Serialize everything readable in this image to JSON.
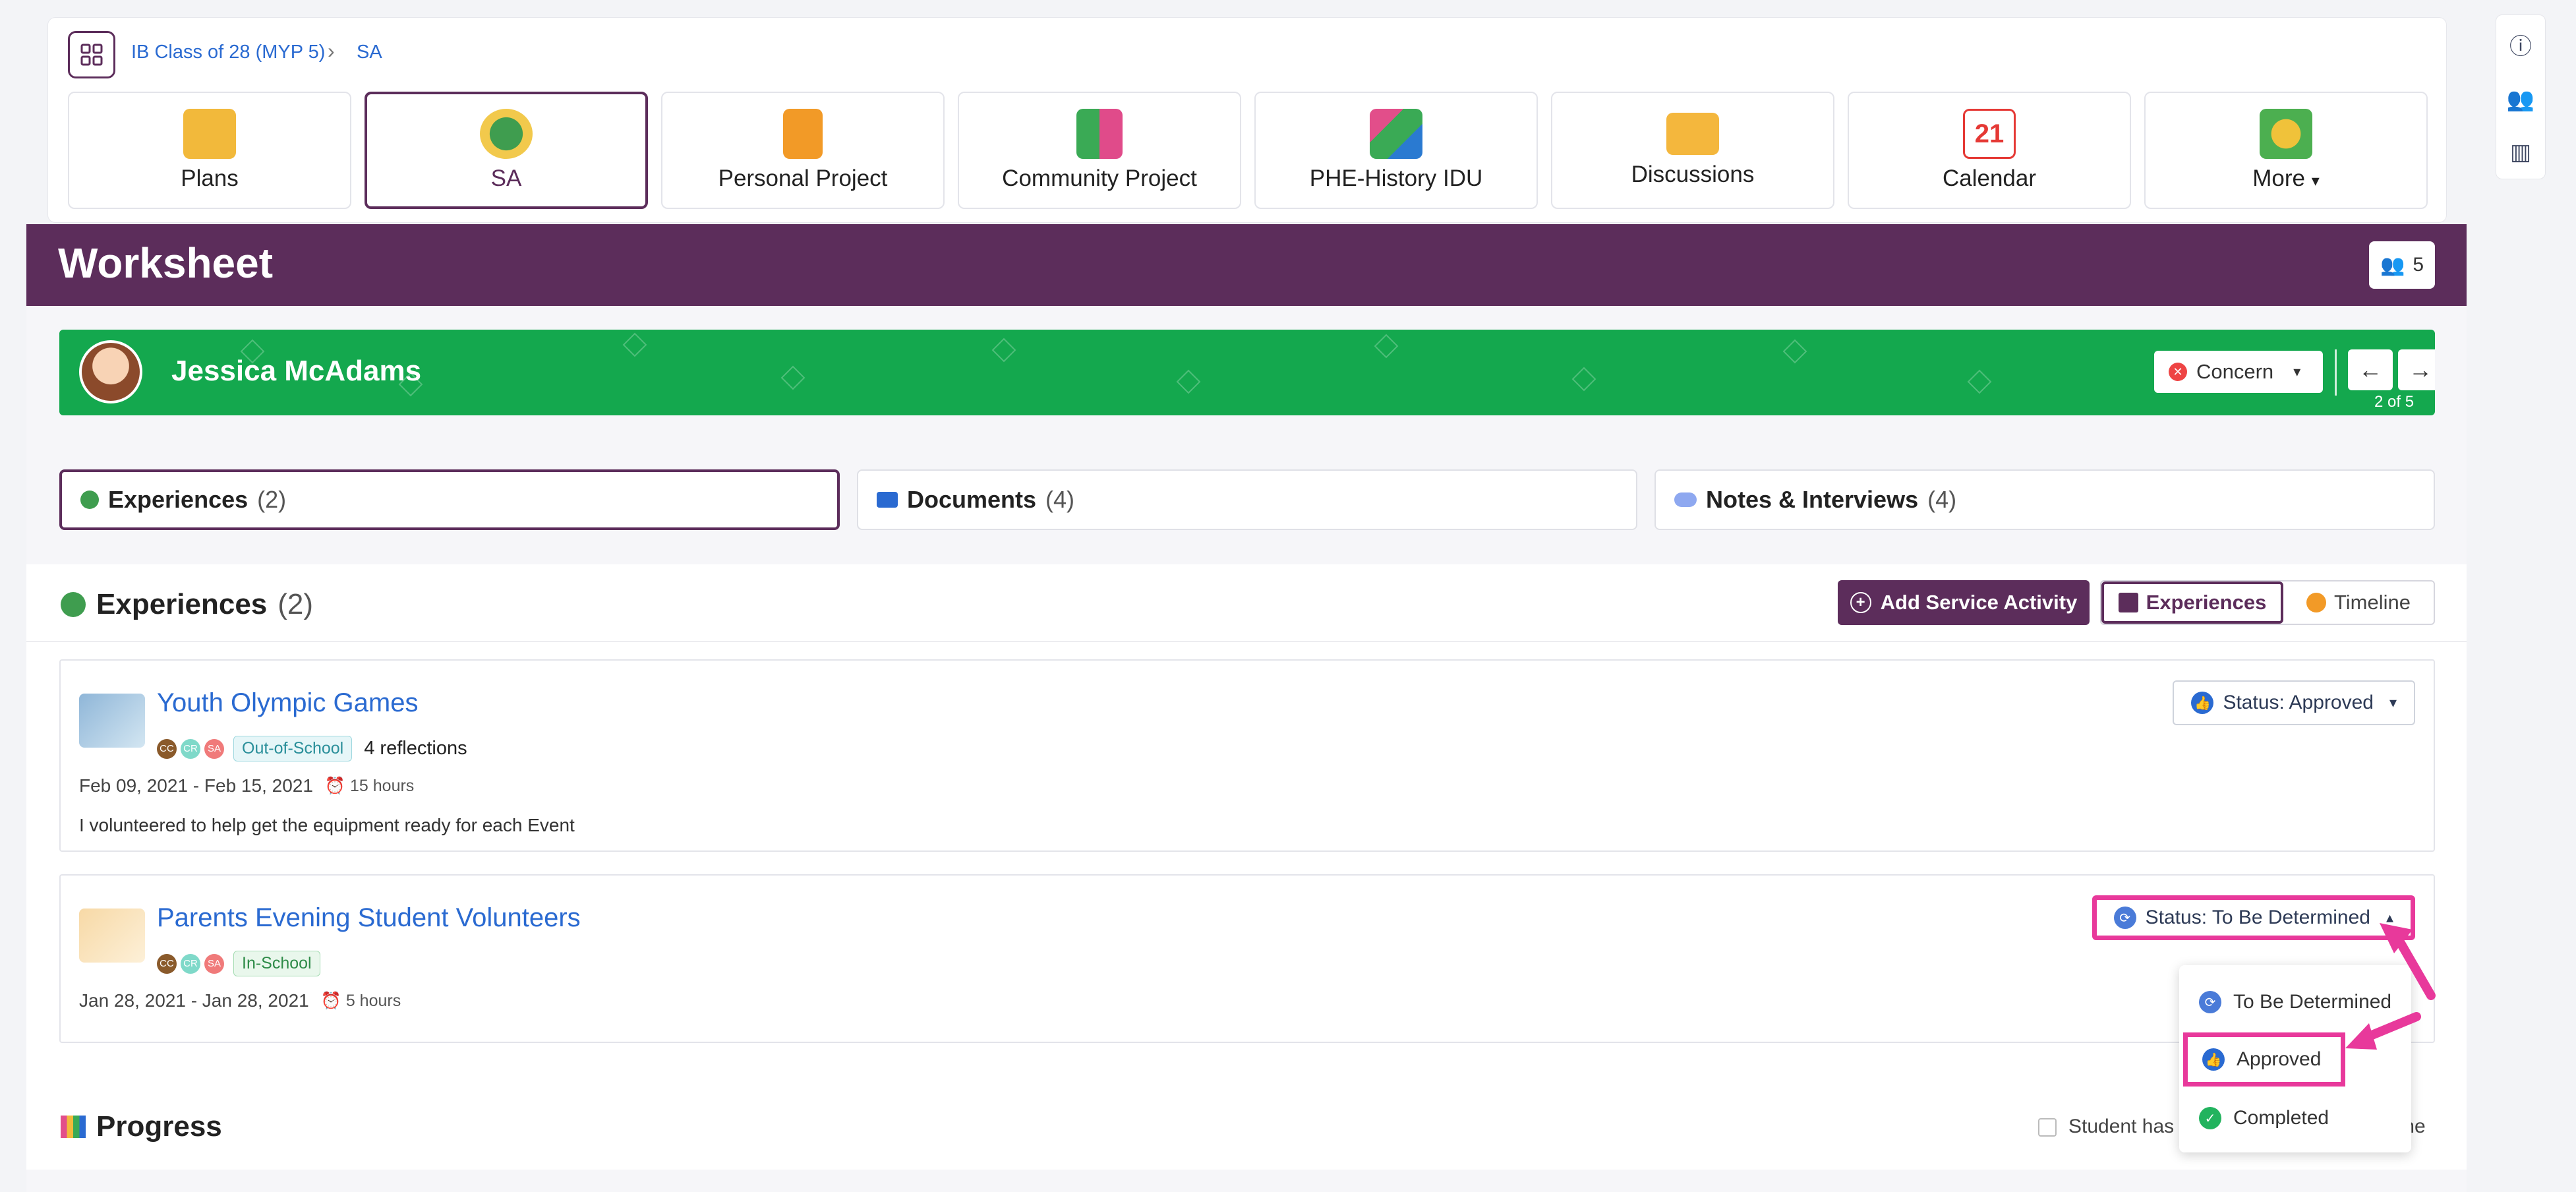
{
  "breadcrumb": [
    "IB Class of 28 (MYP 5)",
    "SA"
  ],
  "nav_tabs": [
    {
      "label": "Plans",
      "icon": "plans-folder-icon",
      "color": "#f2b93b"
    },
    {
      "label": "SA",
      "icon": "globe-hands-icon",
      "color": "#3f9d4f"
    },
    {
      "label": "Personal Project",
      "icon": "notebook-pencil-icon",
      "color": "#f29a27"
    },
    {
      "label": "Community Project",
      "icon": "books-icon",
      "color": "#3aaa55"
    },
    {
      "label": "PHE-History IDU",
      "icon": "puzzle-icon",
      "color": "#e24e8a"
    },
    {
      "label": "Discussions",
      "icon": "envelope-icon",
      "color": "#f4b73d"
    },
    {
      "label": "Calendar",
      "icon": "calendar-icon",
      "color": "#e53935"
    },
    {
      "label": "More",
      "icon": "lightbulb-chat-icon",
      "color": "#f0c23a"
    }
  ],
  "calendar_day": "21",
  "worksheet": {
    "title": "Worksheet",
    "student_count": "5"
  },
  "student": {
    "name": "Jessica McAdams",
    "concern_label": "Concern",
    "position": "2 of 5"
  },
  "subtabs": [
    {
      "label": "Experiences",
      "count": "(2)"
    },
    {
      "label": "Documents",
      "count": "(4)"
    },
    {
      "label": "Notes & Interviews",
      "count": "(4)"
    }
  ],
  "experiences": {
    "title": "Experiences",
    "count": "(2)",
    "add_button": "Add Service Activity",
    "view_experiences": "Experiences",
    "view_timeline": "Timeline"
  },
  "cards": [
    {
      "title": "Youth Olympic Games",
      "badges": [
        "CC",
        "CR",
        "SA"
      ],
      "tag": "Out-of-School",
      "reflections": "4 reflections",
      "dates": "Feb 09, 2021 - Feb 15, 2021",
      "hours": "15 hours",
      "description": "I volunteered to help get the equipment ready for each Event",
      "status": "Status: Approved"
    },
    {
      "title": "Parents Evening Student Volunteers",
      "badges": [
        "CC",
        "CR",
        "SA"
      ],
      "tag": "In-School",
      "dates": "Jan 28, 2021 - Jan 28, 2021",
      "hours": "5 hours",
      "status": "Status: To Be Determined"
    }
  ],
  "status_options": [
    "To Be Determined",
    "Approved",
    "Completed"
  ],
  "progress": {
    "title": "Progress",
    "checkbox_label_start": "Student has",
    "checkbox_label_end": "me"
  },
  "colors": {
    "brand": "#5c2d5b",
    "student_bar": "#14a84e",
    "highlight": "#e8399b",
    "link": "#2a6ad1"
  }
}
